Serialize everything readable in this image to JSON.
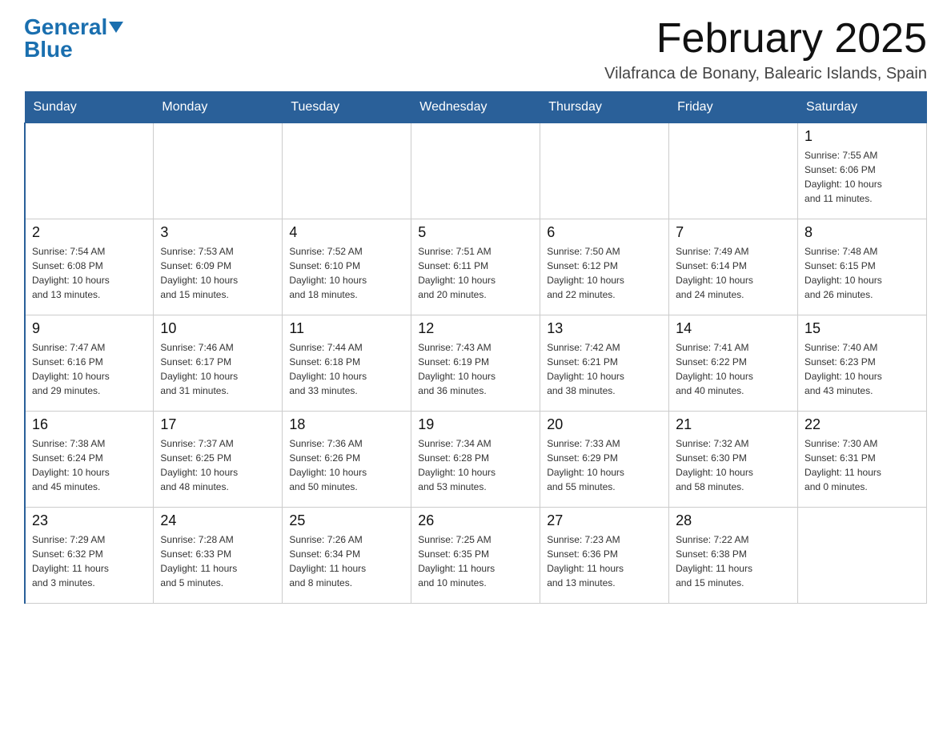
{
  "header": {
    "logo_general": "General",
    "logo_blue": "Blue",
    "month_title": "February 2025",
    "location": "Vilafranca de Bonany, Balearic Islands, Spain"
  },
  "weekdays": [
    "Sunday",
    "Monday",
    "Tuesday",
    "Wednesday",
    "Thursday",
    "Friday",
    "Saturday"
  ],
  "weeks": [
    [
      {
        "day": "",
        "info": ""
      },
      {
        "day": "",
        "info": ""
      },
      {
        "day": "",
        "info": ""
      },
      {
        "day": "",
        "info": ""
      },
      {
        "day": "",
        "info": ""
      },
      {
        "day": "",
        "info": ""
      },
      {
        "day": "1",
        "info": "Sunrise: 7:55 AM\nSunset: 6:06 PM\nDaylight: 10 hours\nand 11 minutes."
      }
    ],
    [
      {
        "day": "2",
        "info": "Sunrise: 7:54 AM\nSunset: 6:08 PM\nDaylight: 10 hours\nand 13 minutes."
      },
      {
        "day": "3",
        "info": "Sunrise: 7:53 AM\nSunset: 6:09 PM\nDaylight: 10 hours\nand 15 minutes."
      },
      {
        "day": "4",
        "info": "Sunrise: 7:52 AM\nSunset: 6:10 PM\nDaylight: 10 hours\nand 18 minutes."
      },
      {
        "day": "5",
        "info": "Sunrise: 7:51 AM\nSunset: 6:11 PM\nDaylight: 10 hours\nand 20 minutes."
      },
      {
        "day": "6",
        "info": "Sunrise: 7:50 AM\nSunset: 6:12 PM\nDaylight: 10 hours\nand 22 minutes."
      },
      {
        "day": "7",
        "info": "Sunrise: 7:49 AM\nSunset: 6:14 PM\nDaylight: 10 hours\nand 24 minutes."
      },
      {
        "day": "8",
        "info": "Sunrise: 7:48 AM\nSunset: 6:15 PM\nDaylight: 10 hours\nand 26 minutes."
      }
    ],
    [
      {
        "day": "9",
        "info": "Sunrise: 7:47 AM\nSunset: 6:16 PM\nDaylight: 10 hours\nand 29 minutes."
      },
      {
        "day": "10",
        "info": "Sunrise: 7:46 AM\nSunset: 6:17 PM\nDaylight: 10 hours\nand 31 minutes."
      },
      {
        "day": "11",
        "info": "Sunrise: 7:44 AM\nSunset: 6:18 PM\nDaylight: 10 hours\nand 33 minutes."
      },
      {
        "day": "12",
        "info": "Sunrise: 7:43 AM\nSunset: 6:19 PM\nDaylight: 10 hours\nand 36 minutes."
      },
      {
        "day": "13",
        "info": "Sunrise: 7:42 AM\nSunset: 6:21 PM\nDaylight: 10 hours\nand 38 minutes."
      },
      {
        "day": "14",
        "info": "Sunrise: 7:41 AM\nSunset: 6:22 PM\nDaylight: 10 hours\nand 40 minutes."
      },
      {
        "day": "15",
        "info": "Sunrise: 7:40 AM\nSunset: 6:23 PM\nDaylight: 10 hours\nand 43 minutes."
      }
    ],
    [
      {
        "day": "16",
        "info": "Sunrise: 7:38 AM\nSunset: 6:24 PM\nDaylight: 10 hours\nand 45 minutes."
      },
      {
        "day": "17",
        "info": "Sunrise: 7:37 AM\nSunset: 6:25 PM\nDaylight: 10 hours\nand 48 minutes."
      },
      {
        "day": "18",
        "info": "Sunrise: 7:36 AM\nSunset: 6:26 PM\nDaylight: 10 hours\nand 50 minutes."
      },
      {
        "day": "19",
        "info": "Sunrise: 7:34 AM\nSunset: 6:28 PM\nDaylight: 10 hours\nand 53 minutes."
      },
      {
        "day": "20",
        "info": "Sunrise: 7:33 AM\nSunset: 6:29 PM\nDaylight: 10 hours\nand 55 minutes."
      },
      {
        "day": "21",
        "info": "Sunrise: 7:32 AM\nSunset: 6:30 PM\nDaylight: 10 hours\nand 58 minutes."
      },
      {
        "day": "22",
        "info": "Sunrise: 7:30 AM\nSunset: 6:31 PM\nDaylight: 11 hours\nand 0 minutes."
      }
    ],
    [
      {
        "day": "23",
        "info": "Sunrise: 7:29 AM\nSunset: 6:32 PM\nDaylight: 11 hours\nand 3 minutes."
      },
      {
        "day": "24",
        "info": "Sunrise: 7:28 AM\nSunset: 6:33 PM\nDaylight: 11 hours\nand 5 minutes."
      },
      {
        "day": "25",
        "info": "Sunrise: 7:26 AM\nSunset: 6:34 PM\nDaylight: 11 hours\nand 8 minutes."
      },
      {
        "day": "26",
        "info": "Sunrise: 7:25 AM\nSunset: 6:35 PM\nDaylight: 11 hours\nand 10 minutes."
      },
      {
        "day": "27",
        "info": "Sunrise: 7:23 AM\nSunset: 6:36 PM\nDaylight: 11 hours\nand 13 minutes."
      },
      {
        "day": "28",
        "info": "Sunrise: 7:22 AM\nSunset: 6:38 PM\nDaylight: 11 hours\nand 15 minutes."
      },
      {
        "day": "",
        "info": ""
      }
    ]
  ]
}
